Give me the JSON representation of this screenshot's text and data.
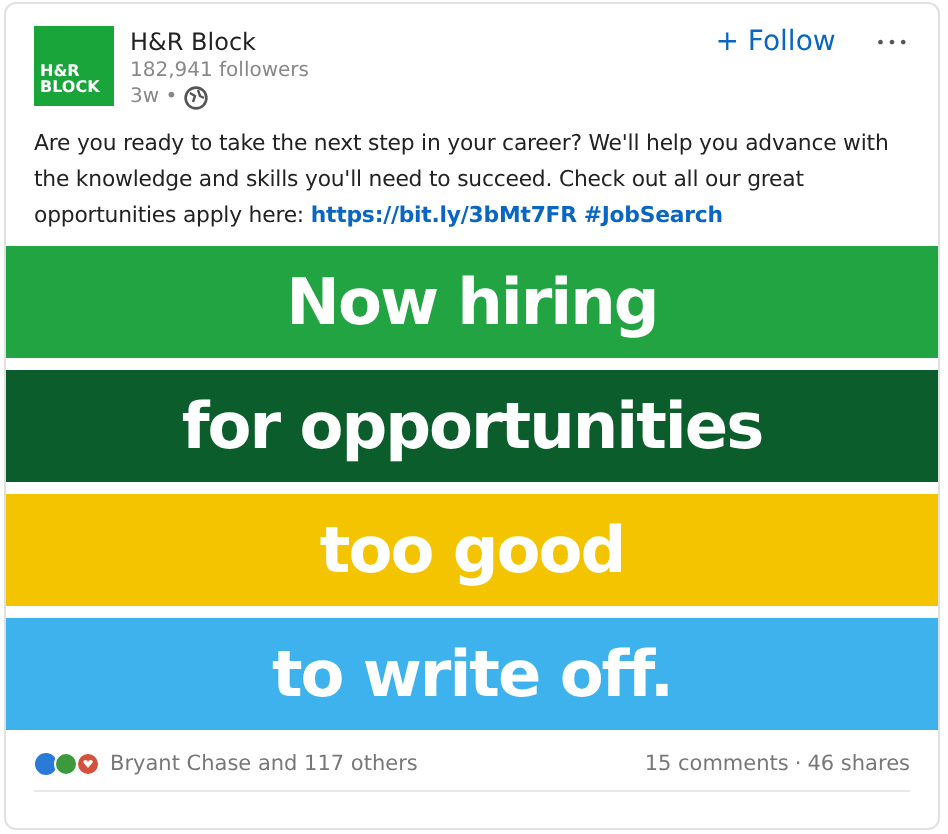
{
  "post": {
    "logo": [
      "H&R",
      "BLOCK"
    ],
    "author": "H&R Block",
    "followers": "182,941 followers",
    "age": "3w •",
    "follow": "+ Follow",
    "more": "•••",
    "body": "Are you ready to take the next step in your career? We'll help you advance with the knowledge and skills you'll need to succeed. Check out all our great opportunities apply here:",
    "links": [
      "https://bit.ly/3bMt7FR",
      "#JobSearch"
    ]
  },
  "banner": [
    {
      "text": "Now hiring",
      "color": "#22a443"
    },
    {
      "text": "for opportunities",
      "color": "#0b5e2b"
    },
    {
      "text": "too good",
      "color": "#f4c400"
    },
    {
      "text": "to write off.",
      "color": "#3eb2ec"
    }
  ],
  "footer": {
    "reactions": "Bryant Chase and 117 others",
    "comments": "15 comments",
    "separator": "·",
    "shares": "46 shares"
  }
}
